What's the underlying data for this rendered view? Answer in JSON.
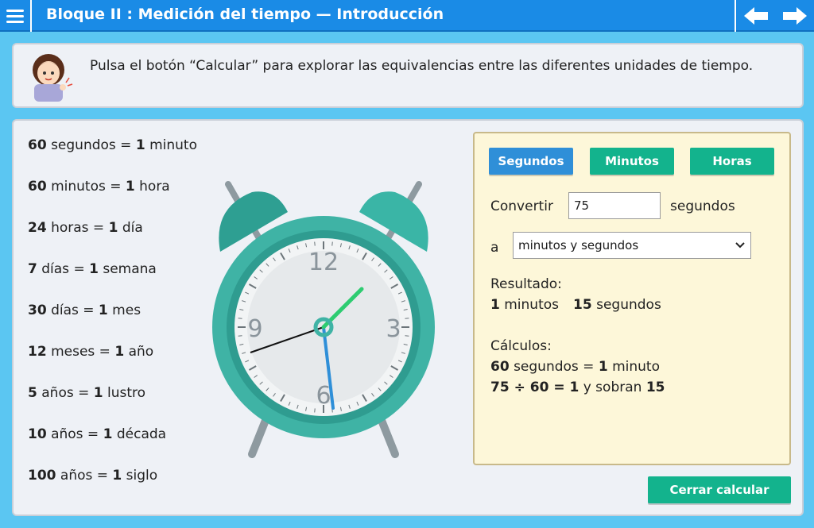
{
  "header": {
    "title": "Bloque II : Medición del tiempo  —  Introducción"
  },
  "instruction": {
    "text": "Pulsa el botón “Calcular” para explorar las equivalencias entre las diferentes unidades de tiempo."
  },
  "equivalences": [
    {
      "left_num": "60",
      "left_unit": "segundos =",
      "right_num": "1",
      "right_unit": "minuto"
    },
    {
      "left_num": "60",
      "left_unit": "minutos =",
      "right_num": "1",
      "right_unit": "hora"
    },
    {
      "left_num": "24",
      "left_unit": "horas =",
      "right_num": "1",
      "right_unit": "día"
    },
    {
      "left_num": "7",
      "left_unit": "días =",
      "right_num": "1",
      "right_unit": "semana"
    },
    {
      "left_num": "30",
      "left_unit": "días =",
      "right_num": "1",
      "right_unit": "mes"
    },
    {
      "left_num": "12",
      "left_unit": "meses =",
      "right_num": "1",
      "right_unit": "año"
    },
    {
      "left_num": "5",
      "left_unit": "años =",
      "right_num": "1",
      "right_unit": "lustro"
    },
    {
      "left_num": "10",
      "left_unit": "años =",
      "right_num": "1",
      "right_unit": "década"
    },
    {
      "left_num": "100",
      "left_unit": "años =",
      "right_num": "1",
      "right_unit": "siglo"
    }
  ],
  "clock": {
    "numbers": {
      "twelve": "12",
      "three": "3",
      "six": "6",
      "nine": "9"
    },
    "hand_colors": {
      "hour": "#2ecc71",
      "minute": "#2f8fd8",
      "second": "#111111"
    },
    "body_color": "#3fb3a5"
  },
  "calculator": {
    "tabs": {
      "seconds": "Segundos",
      "minutes": "Minutos",
      "hours": "Horas"
    },
    "convert_label": "Convertir",
    "input_value": "75",
    "unit_label": "segundos",
    "to_label": "a",
    "select_value": "minutos y segundos",
    "result_title": "Resultado:",
    "result": {
      "minutes_num": "1",
      "minutes_unit": "minutos",
      "seconds_num": "15",
      "seconds_unit": "segundos"
    },
    "calc_title": "Cálculos:",
    "calc_line1": {
      "num1": "60",
      "text1": "segundos =",
      "num2": "1",
      "text2": "minuto"
    },
    "calc_line2": {
      "expr": "75 ÷ 60 = 1",
      "text": "y sobran",
      "num": "15"
    }
  },
  "close_button": "Cerrar calcular",
  "colors": {
    "header": "#1a8be6",
    "background": "#5bc6f2",
    "tab_active": "#2f8fd8",
    "tab_inactive": "#13b38d"
  }
}
